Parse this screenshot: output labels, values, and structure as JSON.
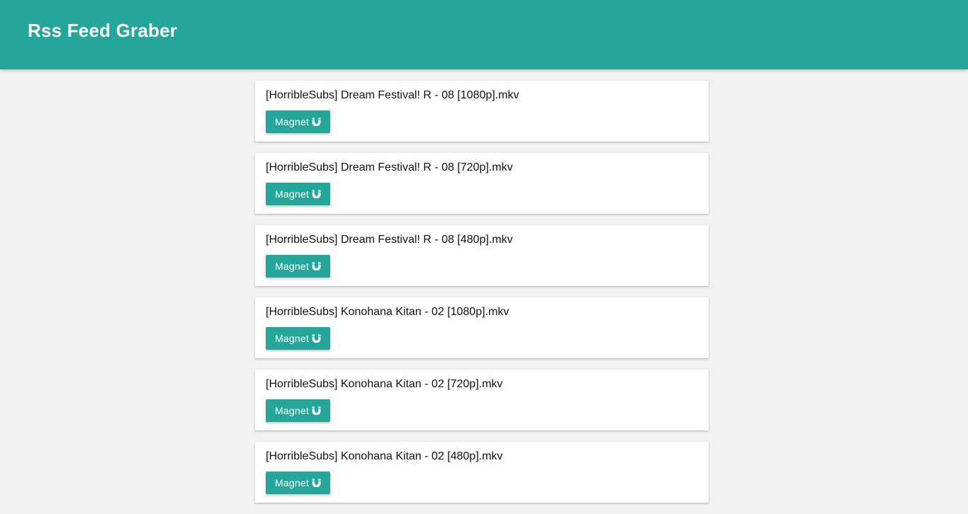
{
  "header": {
    "title": "Rss Feed Graber"
  },
  "colors": {
    "accent": "#26a69a",
    "background": "#f2f2f2",
    "card": "#ffffff"
  },
  "feed": {
    "items": [
      {
        "title": "[HorribleSubs] Dream Festival! R - 08 [1080p].mkv",
        "button_label": "Magnet",
        "icon": "magnet-icon"
      },
      {
        "title": "[HorribleSubs] Dream Festival! R - 08 [720p].mkv",
        "button_label": "Magnet",
        "icon": "magnet-icon"
      },
      {
        "title": "[HorribleSubs] Dream Festival! R - 08 [480p].mkv",
        "button_label": "Magnet",
        "icon": "magnet-icon"
      },
      {
        "title": "[HorribleSubs] Konohana Kitan - 02 [1080p].mkv",
        "button_label": "Magnet",
        "icon": "magnet-icon"
      },
      {
        "title": "[HorribleSubs] Konohana Kitan - 02 [720p].mkv",
        "button_label": "Magnet",
        "icon": "magnet-icon"
      },
      {
        "title": "[HorribleSubs] Konohana Kitan - 02 [480p].mkv",
        "button_label": "Magnet",
        "icon": "magnet-icon"
      }
    ]
  }
}
